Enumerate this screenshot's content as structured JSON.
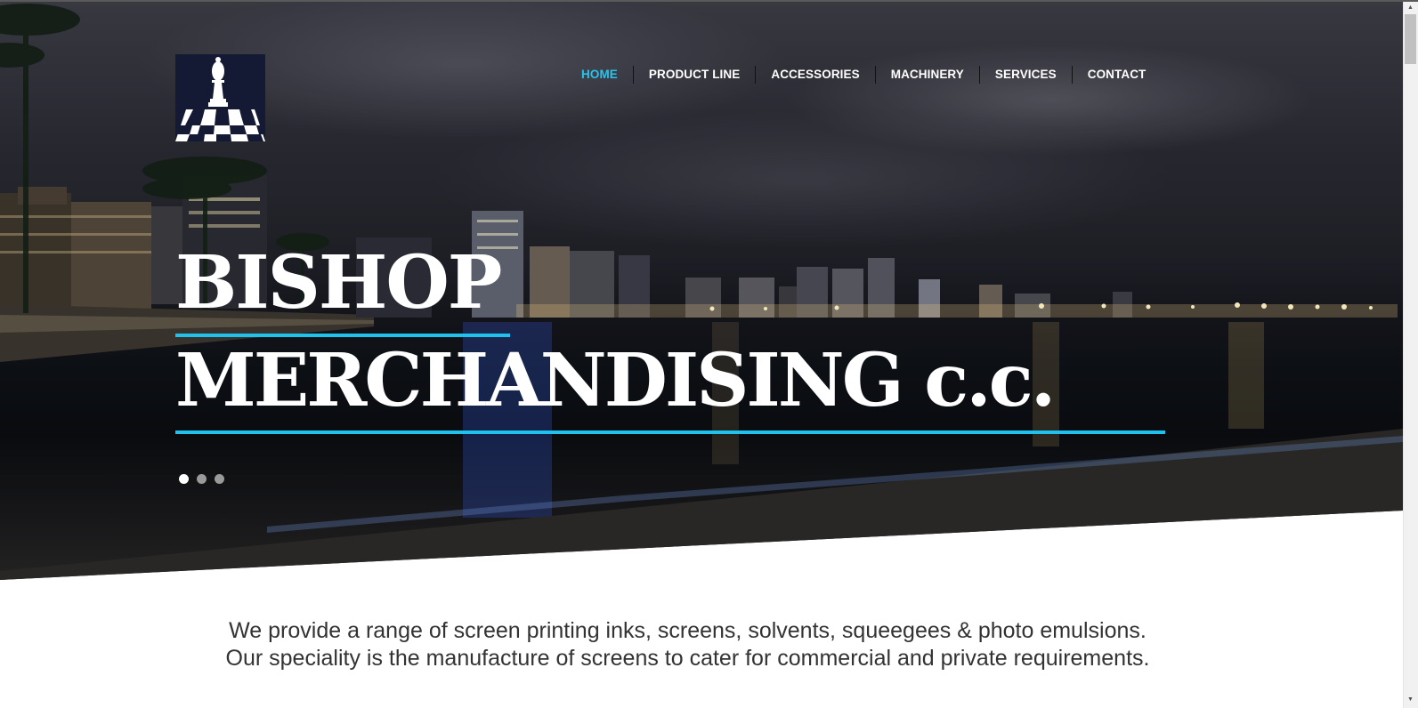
{
  "brand": {
    "logo_icon": "bishop-chess-piece-icon"
  },
  "nav": {
    "items": [
      {
        "label": "HOME",
        "active": true
      },
      {
        "label": "PRODUCT LINE",
        "active": false
      },
      {
        "label": "ACCESSORIES",
        "active": false
      },
      {
        "label": "MACHINERY",
        "active": false
      },
      {
        "label": "SERVICES",
        "active": false
      },
      {
        "label": "CONTACT",
        "active": false
      }
    ]
  },
  "hero": {
    "title_line1": "BISHOP",
    "title_line2": "MERCHANDISING c.c.",
    "slides_count": 3,
    "active_slide": 1
  },
  "intro": {
    "line1": "We provide a range of screen printing inks, screens, solvents, squeegees & photo emulsions.",
    "line2": "Our speciality is the manufacture of screens to cater for commercial and private requirements."
  },
  "colors": {
    "accent": "#1ec2ec",
    "nav_active": "#29c3ee",
    "text": "#333333"
  }
}
